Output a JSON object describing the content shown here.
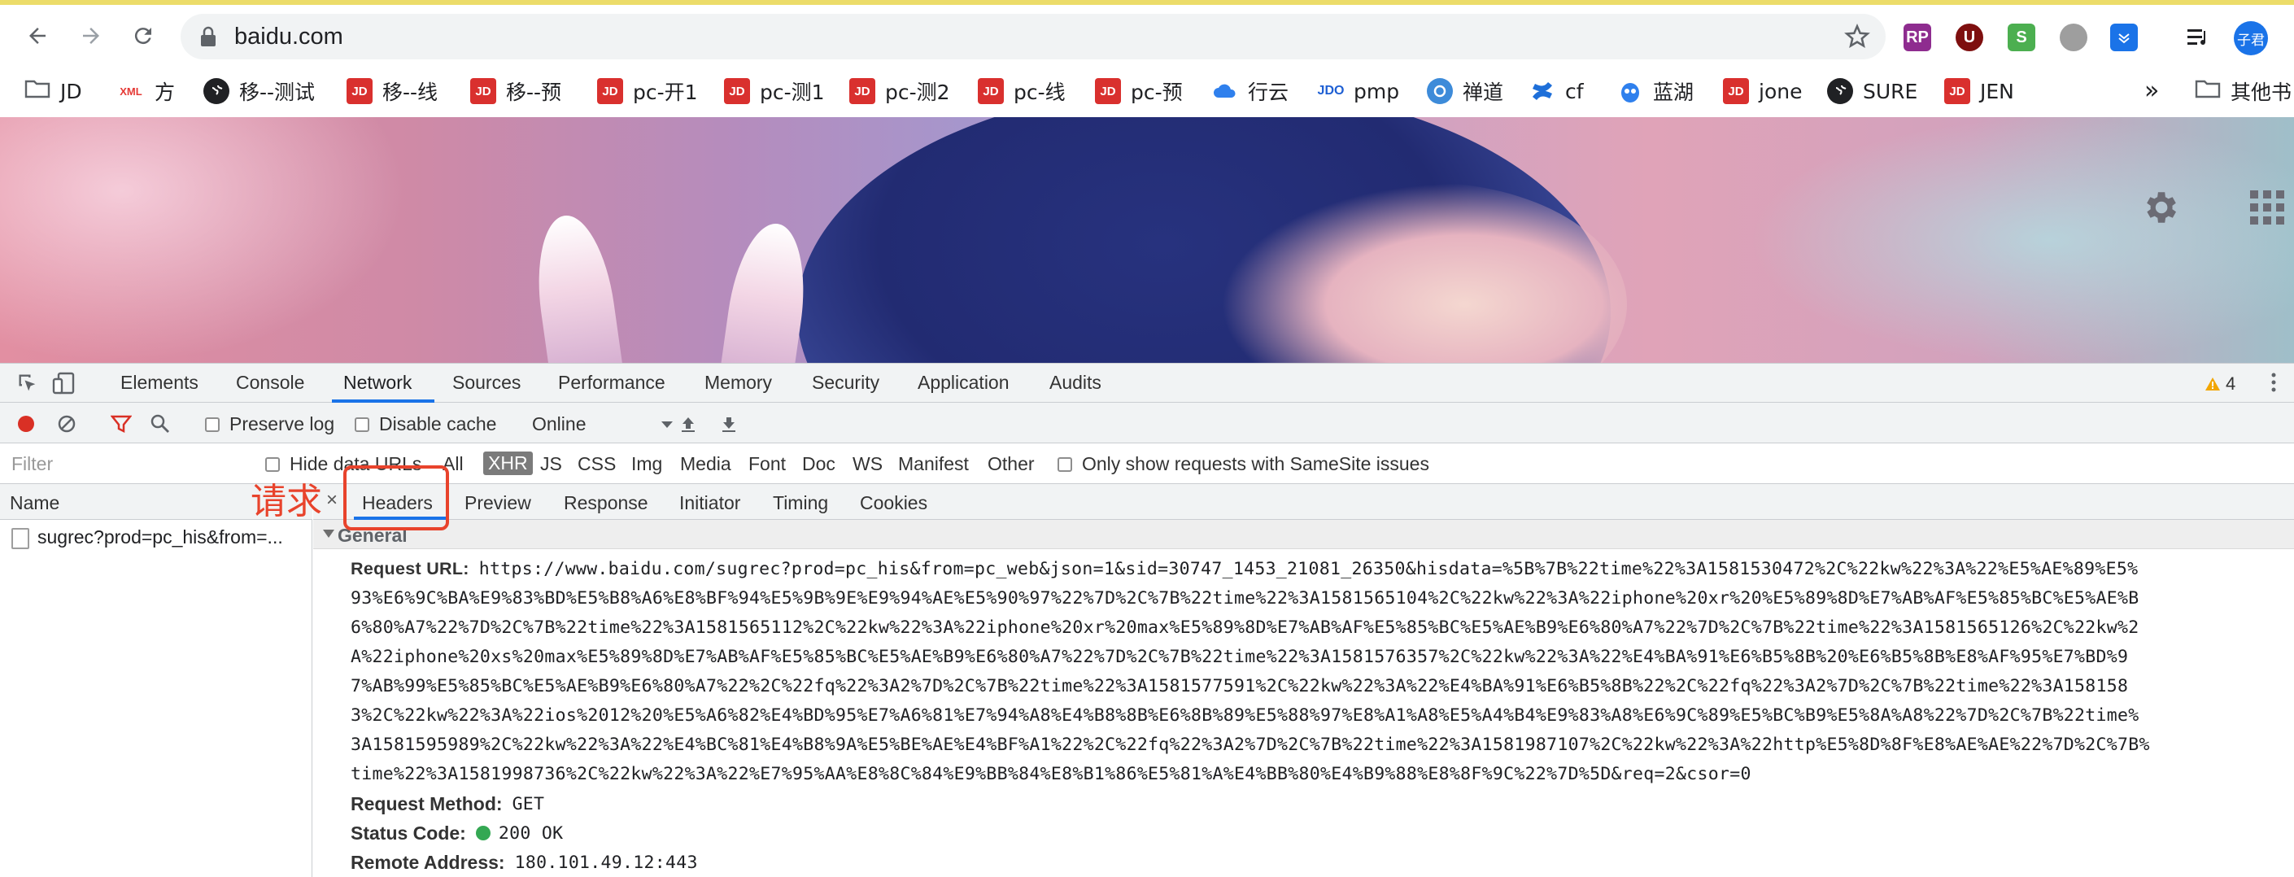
{
  "browser": {
    "url": "baidu.com",
    "profile_label": "子君"
  },
  "bookmarks": [
    {
      "label": "JD",
      "icon": "folder-icon"
    },
    {
      "label": "方",
      "icon": "xml-icon",
      "icon_text": "XML"
    },
    {
      "label": "移--测试",
      "icon": "globe-icon"
    },
    {
      "label": "移--线",
      "icon": "jd-icon",
      "icon_text": "JD"
    },
    {
      "label": "移--预",
      "icon": "jd-icon",
      "icon_text": "JD"
    },
    {
      "label": "pc-开1",
      "icon": "jd-icon",
      "icon_text": "JD"
    },
    {
      "label": "pc-测1",
      "icon": "jd-icon",
      "icon_text": "JD"
    },
    {
      "label": "pc-测2",
      "icon": "jd-icon",
      "icon_text": "JD"
    },
    {
      "label": "pc-线",
      "icon": "jd-icon",
      "icon_text": "JD"
    },
    {
      "label": "pc-预",
      "icon": "jd-icon",
      "icon_text": "JD"
    },
    {
      "label": "行云",
      "icon": "cloud-icon"
    },
    {
      "label": "pmp",
      "icon": "jdo-icon",
      "icon_text": "JDO"
    },
    {
      "label": "禅道",
      "icon": "zentao-icon"
    },
    {
      "label": "cf",
      "icon": "confluence-icon"
    },
    {
      "label": "蓝湖",
      "icon": "lanhu-icon"
    },
    {
      "label": "jone",
      "icon": "jd-icon",
      "icon_text": "JD"
    },
    {
      "label": "SURE",
      "icon": "globe-icon"
    },
    {
      "label": "JEN",
      "icon": "jd-icon",
      "icon_text": "JD"
    }
  ],
  "bookmarks_more": "»",
  "bookmarks_other": "其他书",
  "extensions": [
    {
      "icon": "rp-extension-icon",
      "text": "RP"
    },
    {
      "icon": "ublock-extension-icon",
      "text": "U"
    },
    {
      "icon": "s-extension-icon",
      "text": "S"
    },
    {
      "icon": "circle-extension-icon",
      "text": ""
    },
    {
      "icon": "save-extension-icon",
      "text": ""
    }
  ],
  "devtools": {
    "tabs": [
      "Elements",
      "Console",
      "Network",
      "Sources",
      "Performance",
      "Memory",
      "Security",
      "Application",
      "Audits"
    ],
    "active_tab": "Network",
    "warning_count": "4",
    "toolbar": {
      "preserve_log": "Preserve log",
      "disable_cache": "Disable cache",
      "throttling": "Online"
    },
    "filter": {
      "placeholder": "Filter",
      "hide_data_urls": "Hide data URLs",
      "types": [
        "All",
        "XHR",
        "JS",
        "CSS",
        "Img",
        "Media",
        "Font",
        "Doc",
        "WS",
        "Manifest",
        "Other"
      ],
      "selected_type": "XHR",
      "samesite": "Only show requests with SameSite issues"
    },
    "name_column": "Name",
    "requests": [
      "sugrec?prod=pc_his&from=..."
    ],
    "detail_tabs": [
      "Headers",
      "Preview",
      "Response",
      "Initiator",
      "Timing",
      "Cookies"
    ],
    "active_detail_tab": "Headers",
    "general": {
      "section_title": "General",
      "request_url_label": "Request URL:",
      "request_url_lines": [
        "https://www.baidu.com/sugrec?prod=pc_his&from=pc_web&json=1&sid=30747_1453_21081_26350&hisdata=%5B%7B%22time%22%3A1581530472%2C%22kw%22%3A%22%E5%AE%89%E5%",
        "93%E6%9C%BA%E9%83%BD%E5%B8%A6%E8%BF%94%E5%9B%9E%E9%94%AE%E5%90%97%22%7D%2C%7B%22time%22%3A1581565104%2C%22kw%22%3A%22iphone%20xr%20%E5%89%8D%E7%AB%AF%E5%85%BC%E5%AE%B",
        "6%80%A7%22%7D%2C%7B%22time%22%3A1581565112%2C%22kw%22%3A%22iphone%20xr%20max%E5%89%8D%E7%AB%AF%E5%85%BC%E5%AE%B9%E6%80%A7%22%7D%2C%7B%22time%22%3A1581565126%2C%22kw%2",
        "A%22iphone%20xs%20max%E5%89%8D%E7%AB%AF%E5%85%BC%E5%AE%B9%E6%80%A7%22%7D%2C%7B%22time%22%3A1581576357%2C%22kw%22%3A%22%E4%BA%91%E6%B5%8B%20%E6%B5%8B%E8%AF%95%E7%BD%9",
        "7%AB%99%E5%85%BC%E5%AE%B9%E6%80%A7%22%2C%22fq%22%3A2%7D%2C%7B%22time%22%3A1581577591%2C%22kw%22%3A%22%E4%BA%91%E6%B5%8B%22%2C%22fq%22%3A2%7D%2C%7B%22time%22%3A158158",
        "3%2C%22kw%22%3A%22ios%2012%20%E5%A6%82%E4%BD%95%E7%A6%81%E7%94%A8%E4%B8%8B%E6%8B%89%E5%88%97%E8%A1%A8%E5%A4%B4%E9%83%A8%E6%9C%89%E5%BC%B9%E5%8A%A8%22%7D%2C%7B%22time%",
        "3A1581595989%2C%22kw%22%3A%22%E4%BC%81%E4%B8%9A%E5%BE%AE%E4%BF%A1%22%2C%22fq%22%3A2%7D%2C%7B%22time%22%3A1581987107%2C%22kw%22%3A%22http%E5%8D%8F%E8%AE%AE%22%7D%2C%7B%",
        "time%22%3A1581998736%2C%22kw%22%3A%22%E7%95%AA%E8%8C%84%E9%BB%84%E8%B1%86%E5%81%A%E4%BB%80%E4%B9%88%E8%8F%9C%22%7D%5D&req=2&csor=0"
      ],
      "request_method_label": "Request Method:",
      "request_method": "GET",
      "status_code_label": "Status Code:",
      "status_code": "200 OK",
      "remote_address_label": "Remote Address:",
      "remote_address": "180.101.49.12:443"
    }
  },
  "annotation": {
    "text": "请求",
    "color": "#e8432c"
  },
  "colors": {
    "accent": "#1a73e8",
    "jd_red": "#d9302e",
    "status_ok": "#34a853"
  }
}
